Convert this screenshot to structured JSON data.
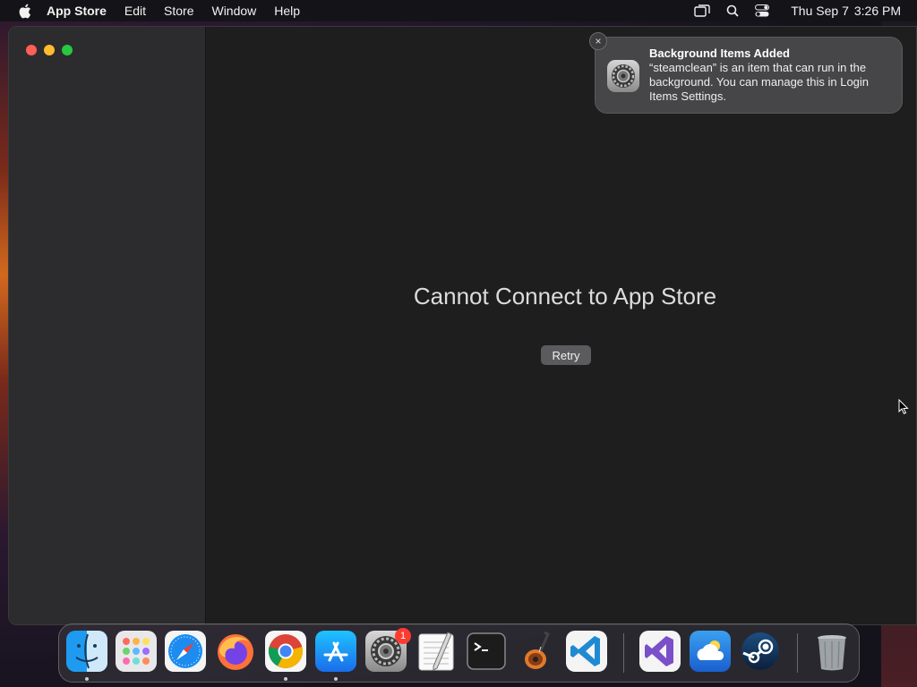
{
  "menubar": {
    "app_name": "App Store",
    "items": [
      "Edit",
      "Store",
      "Window",
      "Help"
    ],
    "date": "Thu Sep 7",
    "time": "3:26 PM"
  },
  "main": {
    "error_title": "Cannot Connect to App Store",
    "retry_label": "Retry"
  },
  "notification": {
    "title": "Background Items Added",
    "body": "“steamclean” is an item that can run in the background. You can manage this in Login Items Settings.",
    "close_glyph": "×"
  },
  "dock": {
    "apps": [
      "finder-icon",
      "launchpad-icon",
      "safari-icon",
      "firefox-icon",
      "chrome-icon",
      "app-store-icon",
      "system-settings-icon",
      "textedit-icon",
      "terminal-icon",
      "garageband-icon",
      "vscode-icon",
      "visual-studio-icon",
      "weather-icon",
      "steam-icon",
      "trash-icon"
    ],
    "settings_badge": "1"
  },
  "colors": {
    "close": "#ff5f57",
    "minimize": "#febc2e",
    "maximize": "#28c840",
    "badge": "#ff3b30"
  }
}
